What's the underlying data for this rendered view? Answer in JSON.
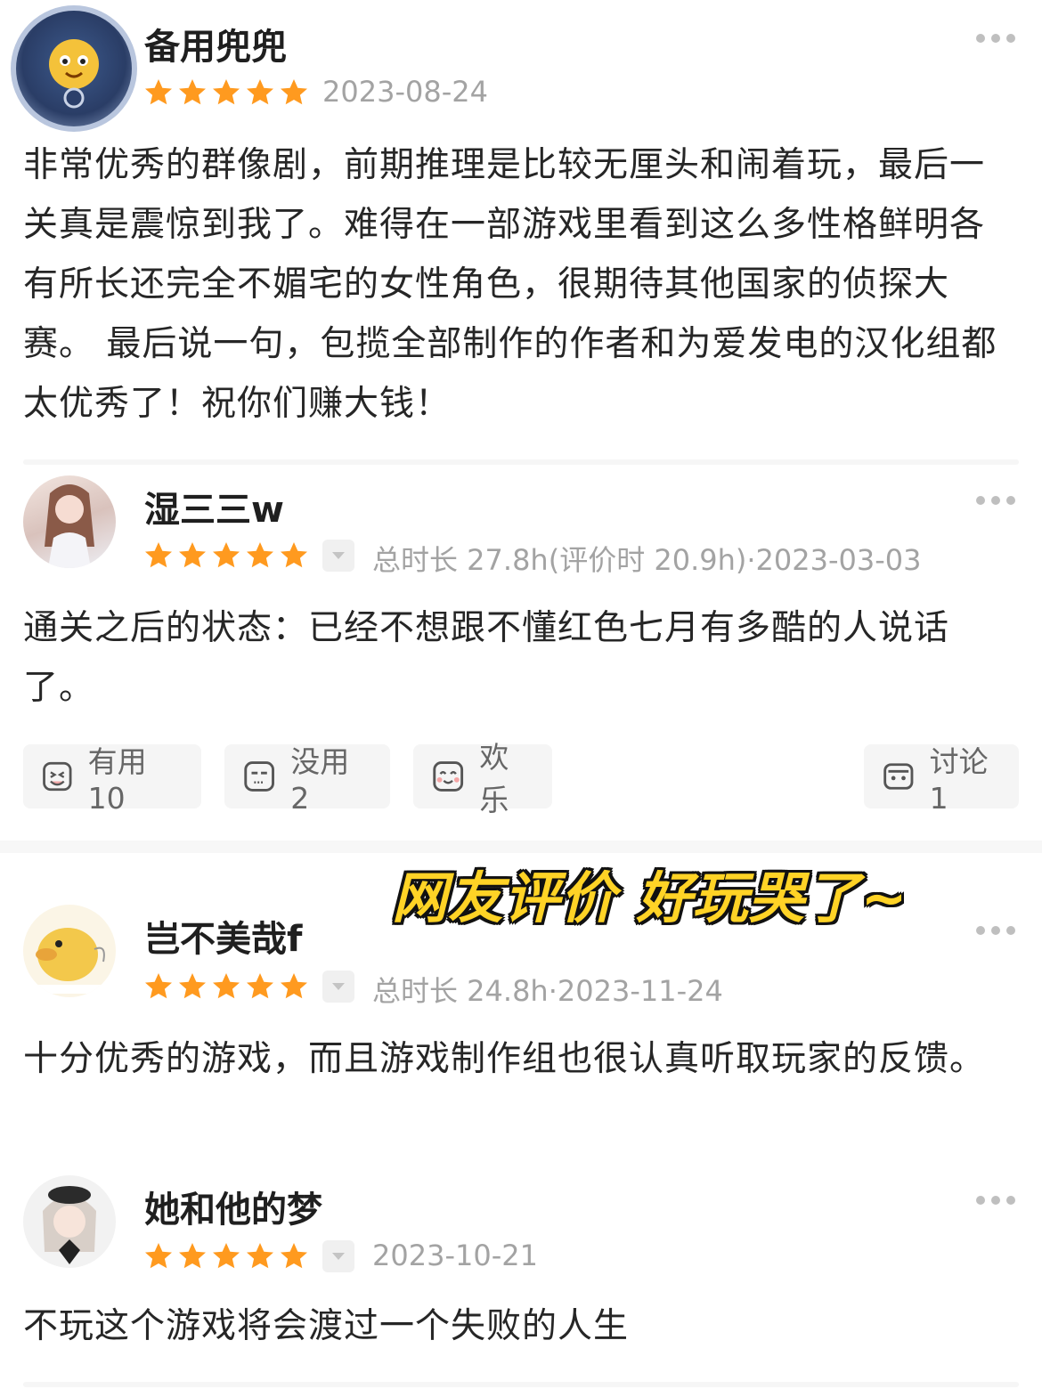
{
  "colors": {
    "star": "#FF9A1F",
    "meta": "#a3a3a3",
    "caption": "#FFD326"
  },
  "reviews": [
    {
      "username": "备用兜兜",
      "rating": 5,
      "meta": "2023-08-24",
      "text": "非常优秀的群像剧，前期推理是比较无厘头和闹着玩，最后一关真是震惊到我了。难得在一部游戏里看到这么多性格鲜明各有所长还完全不媚宅的女性角色，很期待其他国家的侦探大赛。 最后说一句，包揽全部制作的作者和为爱发电的汉化组都太优秀了！祝你们赚大钱！"
    },
    {
      "username": "湿三三w",
      "rating": 5,
      "meta": "总时长 27.8h(评价时 20.9h)·2023-03-03",
      "text": "通关之后的状态：已经不想跟不懂红色七月有多酷的人说话了。",
      "actions": {
        "useful": "有用 10",
        "useless": "没用 2",
        "funny": "欢乐",
        "discuss": "讨论1"
      }
    },
    {
      "username": "岂不美哉f",
      "rating": 5,
      "meta": "总时长 24.8h·2023-11-24",
      "text": "十分优秀的游戏，而且游戏制作组也很认真听取玩家的反馈。"
    },
    {
      "username": "她和他的梦",
      "rating": 5,
      "meta": "2023-10-21",
      "text": "不玩这个游戏将会渡过一个失败的人生"
    }
  ],
  "caption": "网友评价 好玩哭了~"
}
